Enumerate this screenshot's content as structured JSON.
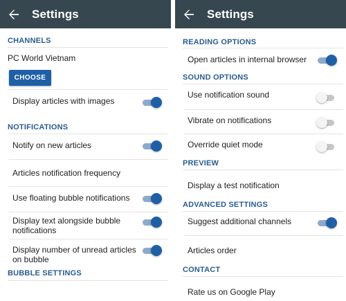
{
  "left": {
    "title": "Settings",
    "channels": {
      "header": "CHANNELS",
      "channel_name": "PC World Vietnam",
      "choose_label": "CHOOSE",
      "display_images_label": "Display articles with images",
      "display_images_on": true
    },
    "notifications": {
      "header": "NOTIFICATIONS",
      "items": [
        {
          "label": "Notify on new articles",
          "on": true
        },
        {
          "label": "Articles notification frequency"
        },
        {
          "label": "Use floating bubble notifications",
          "on": true
        },
        {
          "label_line1": "Display text alongside bubble",
          "label_line2": "notifications",
          "on": true
        },
        {
          "label_line1": "Display number of unread articles",
          "label_line2": "on bubble",
          "on": true
        }
      ]
    },
    "bubble": {
      "header": "BUBBLE SETTINGS"
    }
  },
  "right": {
    "title": "Settings",
    "reading": {
      "header": "READING OPTIONS",
      "internal_browser_label": "Open articles in internal browser",
      "internal_browser_on": true
    },
    "sound": {
      "header": "SOUND OPTIONS",
      "items": [
        {
          "label": "Use notification sound",
          "on": false
        },
        {
          "label": "Vibrate on notifications",
          "on": false
        },
        {
          "label": "Override quiet mode",
          "on": false
        }
      ]
    },
    "preview": {
      "header": "PREVIEW",
      "test_label": "Display a test notification"
    },
    "advanced": {
      "header": "ADVANCED SETTINGS",
      "suggest_label": "Suggest additional channels",
      "suggest_on": true,
      "order_label": "Articles order"
    },
    "contact": {
      "header": "CONTACT",
      "partial_label": "Rate us on Google Play"
    }
  },
  "colors": {
    "appbar": "#37474f",
    "accent": "#1f5fa6",
    "section_header": "#2a5d8f",
    "toggle_track_on": "#8da9cb",
    "toggle_track_off": "#c6c6c6"
  },
  "icons": {
    "back": "arrow-left-icon"
  }
}
